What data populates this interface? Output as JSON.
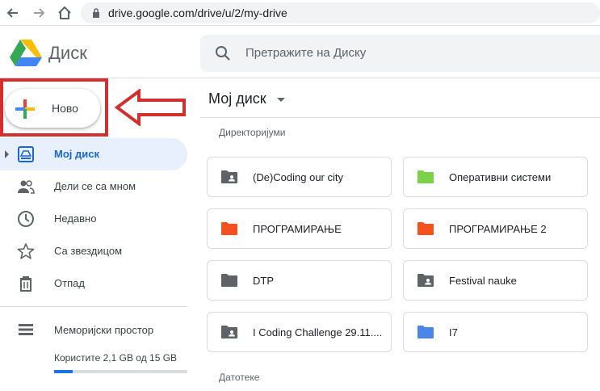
{
  "browser": {
    "url": "drive.google.com/drive/u/2/my-drive"
  },
  "header": {
    "app_name": "Диск",
    "search_placeholder": "Претражите на Диску"
  },
  "sidebar": {
    "new_label": "Ново",
    "items": [
      {
        "label": "Мој диск",
        "icon": "my-drive-icon"
      },
      {
        "label": "Дели се са мном",
        "icon": "shared-icon"
      },
      {
        "label": "Недавно",
        "icon": "clock-icon"
      },
      {
        "label": "Са звездицом",
        "icon": "star-icon"
      },
      {
        "label": "Отпад",
        "icon": "trash-icon"
      }
    ],
    "storage_label": "Меморијски простор",
    "storage_usage": "Користите 2,1 GB од 15 GB",
    "storage_fraction": 0.14
  },
  "main": {
    "title": "Мој диск",
    "folders_label": "Директоријуми",
    "files_label": "Датотеке",
    "folders": [
      {
        "name": "(De)Coding our city",
        "color": "#5f6368",
        "shared": true
      },
      {
        "name": "Оперативни системи",
        "color": "#7bd148",
        "shared": false
      },
      {
        "name": "ПРОГРАМИРАЊЕ",
        "color": "#f4511e",
        "shared": false
      },
      {
        "name": "ПРОГРАМИРАЊЕ 2",
        "color": "#f4511e",
        "shared": false
      },
      {
        "name": "DTP",
        "color": "#5f6368",
        "shared": false
      },
      {
        "name": "Festival nauke",
        "color": "#5f6368",
        "shared": true
      },
      {
        "name": "I Coding Challenge 29.11....",
        "color": "#5f6368",
        "shared": true
      },
      {
        "name": "I7",
        "color": "#4986e7",
        "shared": false
      }
    ]
  },
  "colors": {
    "accent": "#1a73e8",
    "highlight": "#d32f2f"
  }
}
